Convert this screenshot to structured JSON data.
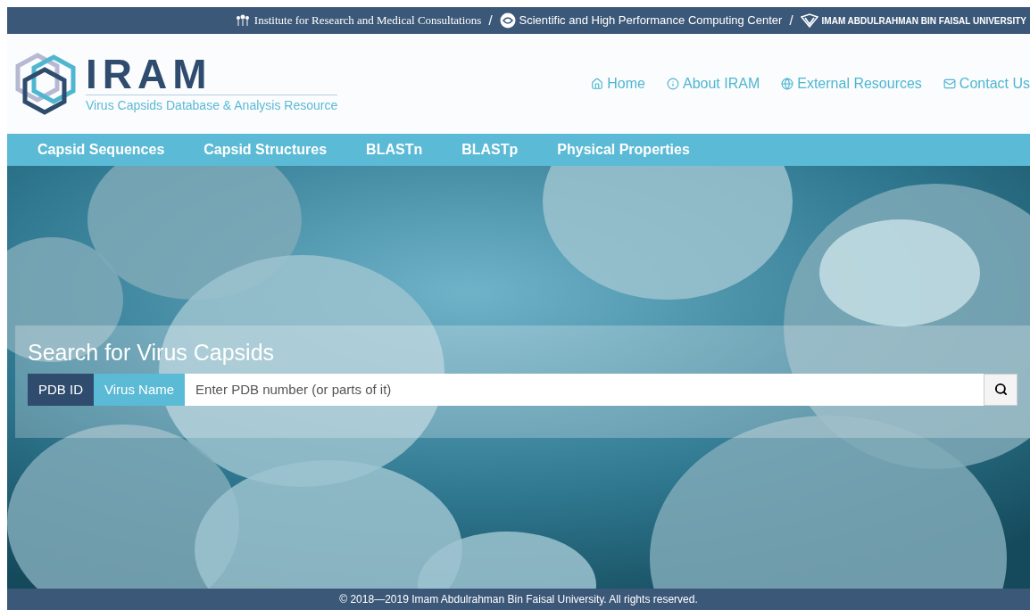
{
  "top_bar": {
    "links": [
      {
        "label": "Institute for Research and Medical Consultations",
        "kind": "institute"
      },
      {
        "label": "Scientific and High Performance Computing Center",
        "kind": "computing"
      },
      {
        "label": "IMAM ABDULRAHMAN BIN FAISAL UNIVERSITY",
        "kind": "university"
      }
    ],
    "separator": "/"
  },
  "header": {
    "logo": {
      "title": "IRAM",
      "subtitle": "Virus Capsids Database & Analysis Resource"
    },
    "nav": [
      {
        "label": "Home",
        "kind": "home"
      },
      {
        "label": "About IRAM",
        "kind": "about"
      },
      {
        "label": "External Resources",
        "kind": "external"
      },
      {
        "label": "Contact Us",
        "kind": "contact"
      }
    ]
  },
  "menu": [
    "Capsid Sequences",
    "Capsid Structures",
    "BLASTn",
    "BLASTp",
    "Physical Properties"
  ],
  "search": {
    "title": "Search for Virus Capsids",
    "tabs": [
      {
        "label": "PDB ID",
        "selected": true
      },
      {
        "label": "Virus Name",
        "selected": false
      }
    ],
    "placeholder": "Enter PDB number (or parts of it)"
  },
  "footer": "© 2018—2019 Imam Abdulrahman Bin Faisal University. All rights reserved."
}
